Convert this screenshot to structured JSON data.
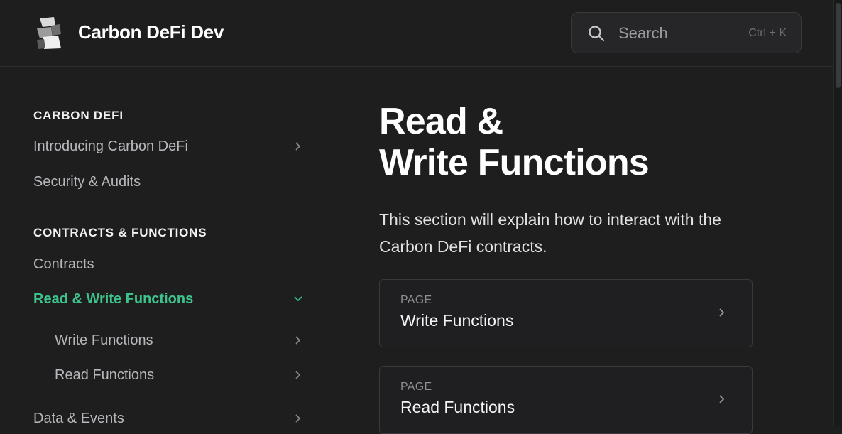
{
  "header": {
    "site_title": "Carbon DeFi Dev",
    "search": {
      "placeholder": "Search",
      "shortcut": "Ctrl + K"
    }
  },
  "sidebar": {
    "sections": [
      {
        "title": "CARBON DEFI",
        "items": [
          {
            "label": "Introducing Carbon DeFi",
            "has_children": true
          },
          {
            "label": "Security & Audits",
            "has_children": false
          }
        ]
      },
      {
        "title": "CONTRACTS & FUNCTIONS",
        "items": [
          {
            "label": "Contracts",
            "has_children": false
          },
          {
            "label": "Read & Write Functions",
            "has_children": true,
            "active": true,
            "expanded": true
          },
          {
            "label": "Write Functions",
            "has_children": true,
            "nested": true
          },
          {
            "label": "Read Functions",
            "has_children": true,
            "nested": true
          },
          {
            "label": "Data & Events",
            "has_children": true
          }
        ]
      }
    ]
  },
  "main": {
    "title_line1": "Read &",
    "title_line2": "Write Functions",
    "intro": "This section will explain how to interact with the Carbon DeFi contracts.",
    "cards": [
      {
        "kicker": "PAGE",
        "title": "Write Functions"
      },
      {
        "kicker": "PAGE",
        "title": "Read Functions"
      }
    ]
  },
  "colors": {
    "background": "#1e1e1f",
    "accent": "#3ec28b",
    "border": "#3a3a3d",
    "text": "#e6e6e6"
  },
  "icons": [
    "logo-icon",
    "search-icon",
    "chevron-right-icon",
    "chevron-down-icon"
  ]
}
